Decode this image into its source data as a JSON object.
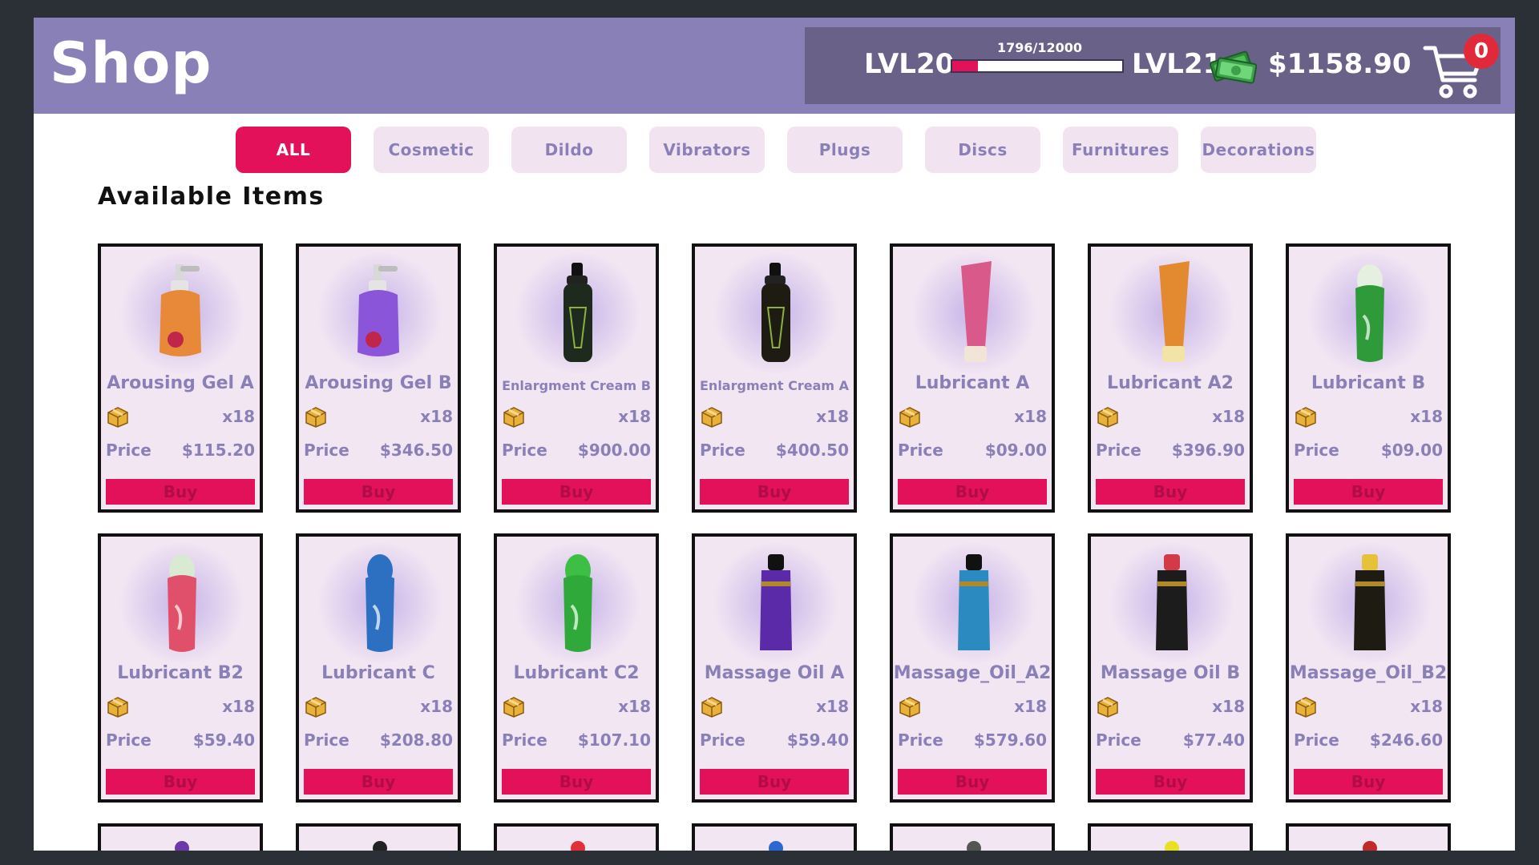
{
  "header": {
    "title": "Shop",
    "level_current": "LVL20",
    "level_next": "LVL21",
    "xp_text": "1796/12000",
    "xp_fraction": 0.15,
    "money": "$1158.90",
    "cart_count": "0"
  },
  "tabs": [
    {
      "label": "ALL",
      "active": true
    },
    {
      "label": "Cosmetic",
      "active": false
    },
    {
      "label": "Dildo",
      "active": false
    },
    {
      "label": "Vibrators",
      "active": false
    },
    {
      "label": "Plugs",
      "active": false
    },
    {
      "label": "Discs",
      "active": false
    },
    {
      "label": "Furnitures",
      "active": false
    },
    {
      "label": "Decorations",
      "active": false
    }
  ],
  "section_title": "Available Items",
  "card_labels": {
    "price": "Price",
    "buy": "Buy"
  },
  "items": [
    {
      "name": "Arousing Gel A",
      "qty": "x18",
      "price": "$115.20",
      "icon": "pump-bottle-orange",
      "color": "#e8893a",
      "cap": "#cfcfcf"
    },
    {
      "name": "Arousing Gel B",
      "qty": "x18",
      "price": "$346.50",
      "icon": "pump-bottle-purple",
      "color": "#8a55d8",
      "cap": "#cfcfcf"
    },
    {
      "name": "Enlargment Cream B",
      "qty": "x18",
      "price": "$900.00",
      "icon": "tall-bottle-green-black",
      "color": "#1f2a1f",
      "cap": "#111111"
    },
    {
      "name": "Enlargment Cream A",
      "qty": "x18",
      "price": "$400.50",
      "icon": "tall-bottle-gold-black",
      "color": "#1e1c12",
      "cap": "#111111"
    },
    {
      "name": "Lubricant A",
      "qty": "x18",
      "price": "$09.00",
      "icon": "tube-pink",
      "color": "#d95a8a",
      "cap": "#f2e4d6"
    },
    {
      "name": "Lubricant A2",
      "qty": "x18",
      "price": "$396.90",
      "icon": "tube-orange",
      "color": "#e38a30",
      "cap": "#f2e4a6"
    },
    {
      "name": "Lubricant B",
      "qty": "x18",
      "price": "$09.00",
      "icon": "bottle-green",
      "color": "#2e9a3a",
      "cap": "#e6f0e0"
    },
    {
      "name": "Lubricant B2",
      "qty": "x18",
      "price": "$59.40",
      "icon": "bottle-red",
      "color": "#e0506a",
      "cap": "#d9ead2"
    },
    {
      "name": "Lubricant C",
      "qty": "x18",
      "price": "$208.80",
      "icon": "bottle-blue",
      "color": "#2d6fc0",
      "cap": "#2d6fc0"
    },
    {
      "name": "Lubricant C2",
      "qty": "x18",
      "price": "$107.10",
      "icon": "bottle-green-bright",
      "color": "#2faa3a",
      "cap": "#3cbf44"
    },
    {
      "name": "Massage Oil A",
      "qty": "x18",
      "price": "$59.40",
      "icon": "oil-bottle-purple",
      "color": "#5a2aa8",
      "cap": "#111111"
    },
    {
      "name": "Massage_Oil_A2",
      "qty": "x18",
      "price": "$579.60",
      "icon": "oil-bottle-blue",
      "color": "#2b8ac0",
      "cap": "#111111"
    },
    {
      "name": "Massage Oil B",
      "qty": "x18",
      "price": "$77.40",
      "icon": "oil-bottle-red",
      "color": "#1c1c1c",
      "cap": "#d23a4a"
    },
    {
      "name": "Massage_Oil_B2",
      "qty": "x18",
      "price": "$246.60",
      "icon": "oil-bottle-yellow",
      "color": "#1e1c12",
      "cap": "#e6c23a"
    }
  ],
  "partial_row": [
    {
      "icon": "item-purple",
      "color": "#6b3aa8"
    },
    {
      "icon": "item-black",
      "color": "#222222"
    },
    {
      "icon": "item-red",
      "color": "#e0303a"
    },
    {
      "icon": "item-blue",
      "color": "#2a6ad0"
    },
    {
      "icon": "item-dark",
      "color": "#555555"
    },
    {
      "icon": "item-yellow",
      "color": "#e8e020"
    },
    {
      "icon": "item-darkred",
      "color": "#c02a2a"
    }
  ]
}
